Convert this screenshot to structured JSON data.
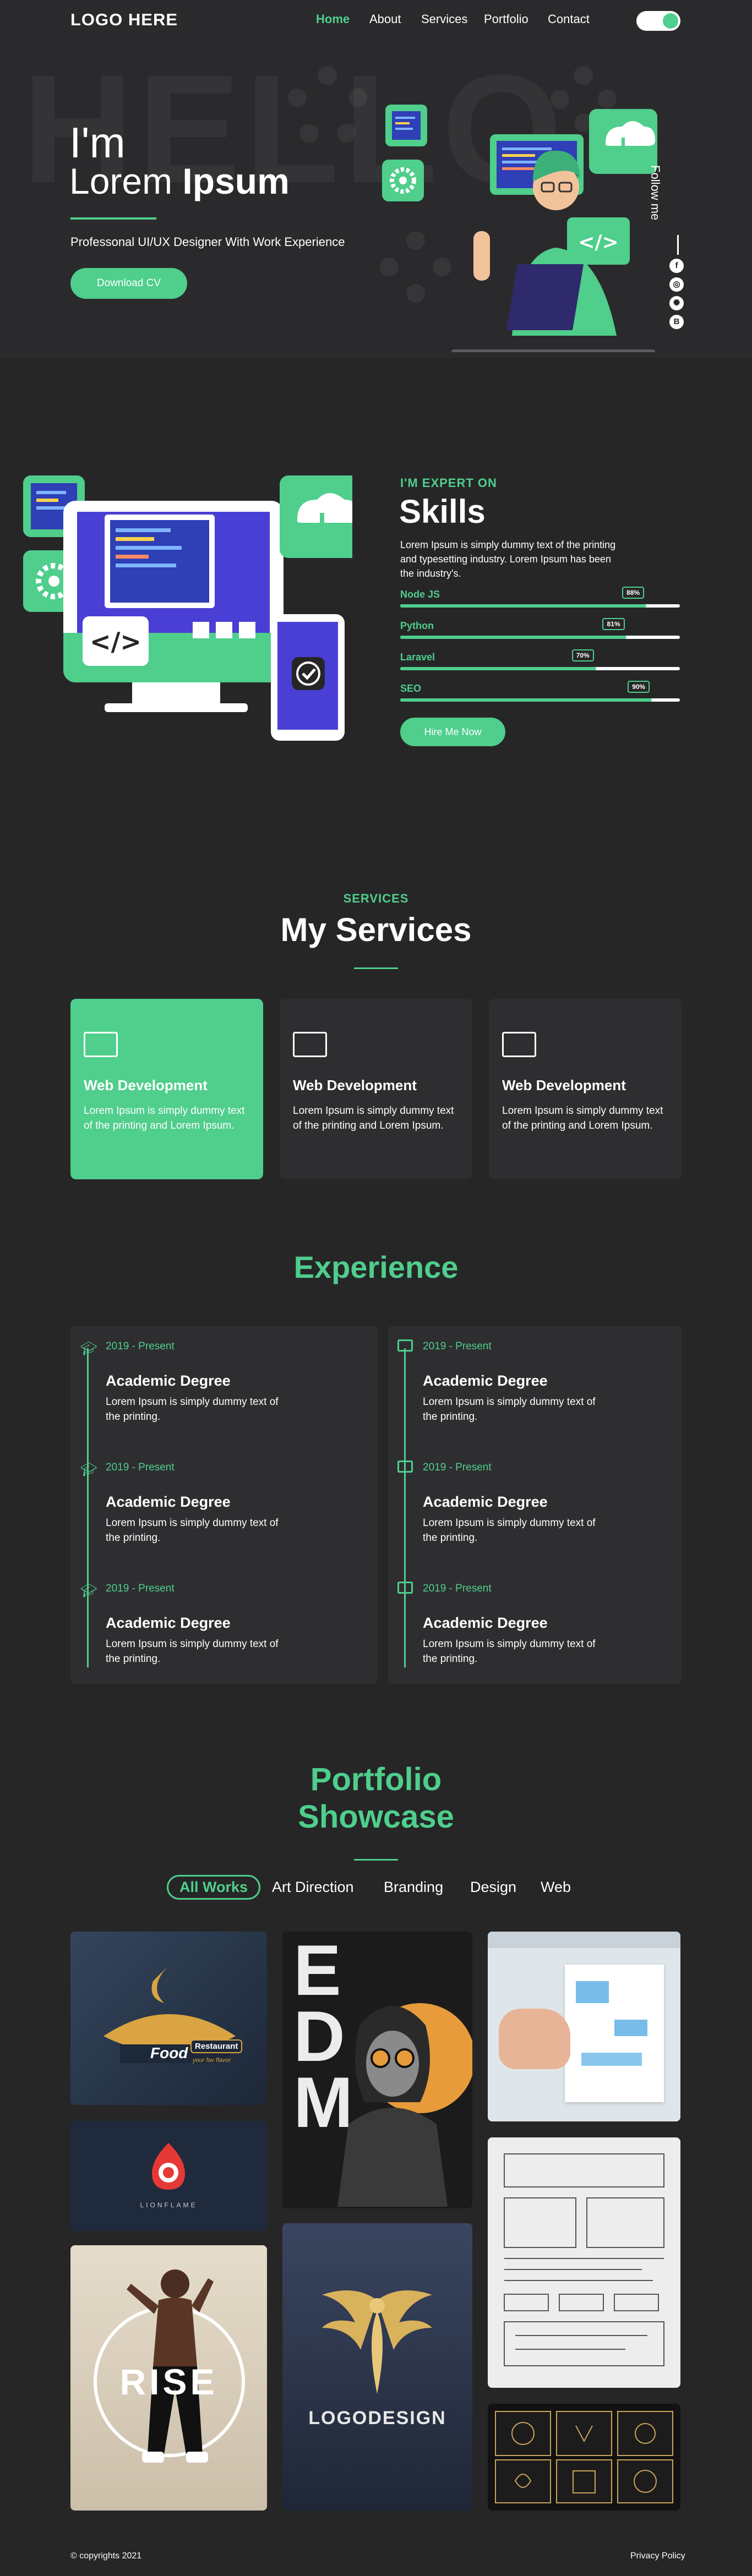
{
  "nav": {
    "logo": "LOGO HERE",
    "links": [
      "Home",
      "About",
      "Services",
      "Portfolio",
      "Contact"
    ],
    "active": "Home"
  },
  "hero": {
    "bg_word": "HELLO",
    "greeting": "I'm",
    "name_first": "Lorem",
    "name_last": "Ipsum",
    "tagline": "Professonal UI/UX Designer With  Work Experience",
    "cta": "Download CV",
    "follow": "Follow me",
    "social_icons": [
      "facebook-icon",
      "instagram-icon",
      "dribbble-icon",
      "behance-icon"
    ]
  },
  "skills": {
    "eyebrow": "I'M EXPERT ON",
    "title": "Skills",
    "description": "Lorem Ipsum is simply dummy text of the printing and typesetting industry. Lorem Ipsum has been the industry's.",
    "items": [
      {
        "name": "Node JS",
        "percent": 88,
        "label": "88%"
      },
      {
        "name": "Python",
        "percent": 81,
        "label": "81%"
      },
      {
        "name": "Laravel",
        "percent": 70,
        "label": "70%"
      },
      {
        "name": "SEO",
        "percent": 90,
        "label": "90%"
      }
    ],
    "cta": "Hire Me Now"
  },
  "services": {
    "eyebrow": "SERVICES",
    "title": "My Services",
    "cards": [
      {
        "title": "Web Development",
        "desc": "Lorem Ipsum is simply dummy text of the printing and Lorem Ipsum.",
        "icon": "browser-icon"
      },
      {
        "title": "Web Development",
        "desc": "Lorem Ipsum is simply dummy text of the printing and Lorem Ipsum.",
        "icon": "sitemap-icon"
      },
      {
        "title": "Web Development",
        "desc": "Lorem Ipsum is simply dummy text of the printing and Lorem Ipsum.",
        "icon": "monitor-icon"
      }
    ]
  },
  "experience": {
    "title": "Experience",
    "left": [
      {
        "date": "2019 - Present",
        "title": "Academic Degree",
        "desc": "Lorem Ipsum is simply dummy text of the printing."
      },
      {
        "date": "2019 - Present",
        "title": "Academic Degree",
        "desc": "Lorem Ipsum is simply dummy text of the printing."
      },
      {
        "date": "2019 - Present",
        "title": "Academic Degree",
        "desc": "Lorem Ipsum is simply dummy text of the printing."
      }
    ],
    "right": [
      {
        "date": "2019 - Present",
        "title": "Academic Degree",
        "desc": "Lorem Ipsum is simply dummy text of the printing."
      },
      {
        "date": "2019 - Present",
        "title": "Academic Degree",
        "desc": "Lorem Ipsum is simply dummy text of the printing."
      },
      {
        "date": "2019 - Present",
        "title": "Academic Degree",
        "desc": "Lorem Ipsum is simply dummy text of the printing."
      }
    ]
  },
  "portfolio": {
    "title_line1": "Portfolio",
    "title_line2": "Showcase",
    "filters": [
      "All Works",
      "Art Direction",
      "Branding",
      "Design",
      "Web"
    ],
    "active_filter": "All Works",
    "tiles": {
      "food": {
        "brand": "Food",
        "badge": "Restaurant",
        "sub": "your fav flavor"
      },
      "lion": {
        "brand": "LIONFLAME"
      },
      "rise": {
        "word": "RISE"
      },
      "edm": {
        "letters": [
          "E",
          "D",
          "M"
        ]
      },
      "logo": {
        "word": "LOGODESIGN"
      }
    }
  },
  "footer": {
    "copyright": "© copyrights 2021",
    "privacy": "Privacy Policy"
  },
  "colors": {
    "accent": "#4fce8c",
    "background": "#262627",
    "card": "#2e2e31"
  }
}
